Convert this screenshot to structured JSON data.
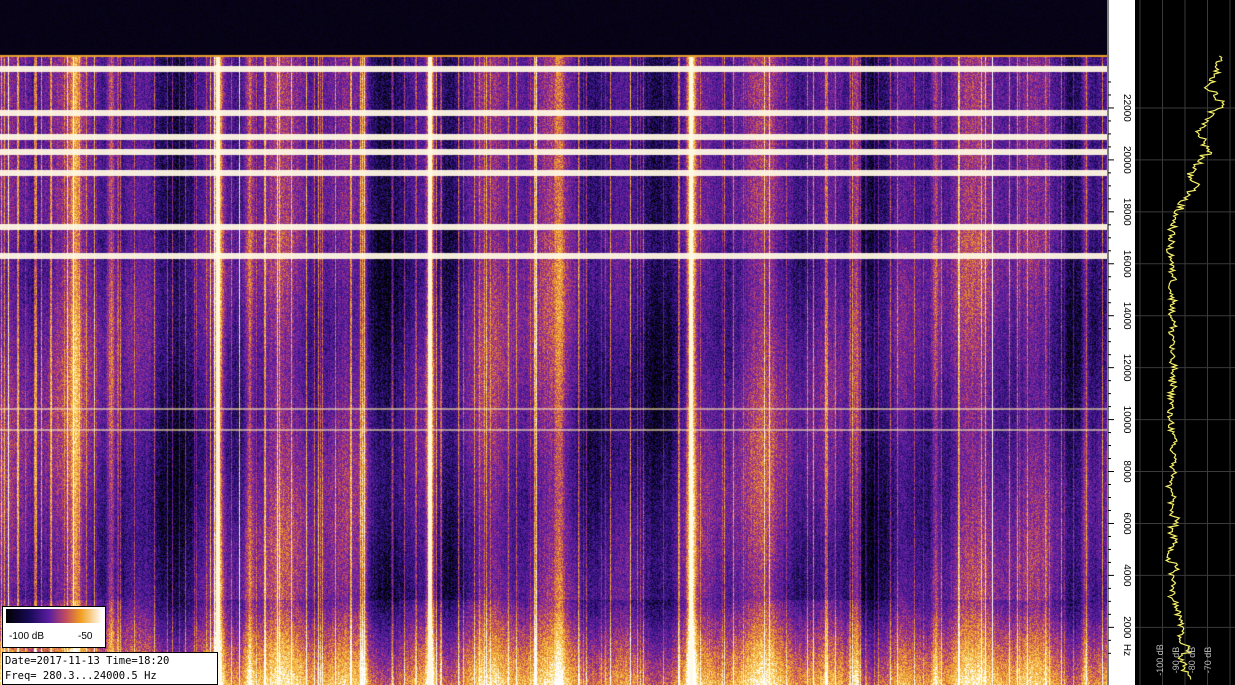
{
  "chart_data": {
    "type": "heatmap",
    "title": "",
    "xlabel": "",
    "ylabel": "Hz",
    "y_axis": {
      "unit": "Hz",
      "ticks": [
        2000,
        4000,
        6000,
        8000,
        10000,
        12000,
        14000,
        16000,
        18000,
        20000,
        22000
      ],
      "range": [
        280.3,
        24000.5
      ],
      "tick_labels": [
        "2000",
        "4000",
        "6000",
        "8000",
        "10000",
        "12000",
        "14000",
        "16000",
        "18000",
        "20000",
        "22000"
      ],
      "unit_label": "Hz"
    },
    "colorbar": {
      "min_label": "-100 dB",
      "max_label": "-50",
      "range_db": [
        -100,
        -50
      ]
    },
    "info": {
      "date_line": "Date=2017-11-13 Time=18:20",
      "freq_line": "Freq= 280.3...24000.5 Hz"
    },
    "horizontal_lines_hz": [
      23500,
      21800,
      20900,
      20300,
      19500,
      17400,
      16300,
      10400,
      9600
    ],
    "vertical_events": [
      {
        "x_frac": 0.197,
        "strength": 0.95
      },
      {
        "x_frac": 0.388,
        "strength": 1.0
      },
      {
        "x_frac": 0.624,
        "strength": 1.0
      },
      {
        "x_frac": 0.773,
        "strength": 0.7
      },
      {
        "x_frac": 0.225,
        "strength": 0.6
      },
      {
        "x_frac": 0.1,
        "strength": 0.6
      },
      {
        "x_frac": 0.328,
        "strength": 0.6
      },
      {
        "x_frac": 0.068,
        "strength": 0.5
      },
      {
        "x_frac": 0.505,
        "strength": 0.4
      },
      {
        "x_frac": 0.845,
        "strength": 0.5
      },
      {
        "x_frac": 0.98,
        "strength": 0.5
      }
    ],
    "spectrum_panel": {
      "axis_labels": [
        "-100 dB",
        "-90 dB",
        "-80 dB",
        "-70 dB"
      ],
      "line_color": "#f5f06a",
      "grid_color": "#3a3a3a",
      "profile_db": [
        -65,
        -66,
        -68,
        -70,
        -67,
        -64,
        -68,
        -71,
        -74,
        -72,
        -69,
        -73,
        -76,
        -78,
        -75,
        -79,
        -82,
        -84,
        -85,
        -86,
        -86,
        -87,
        -86,
        -86,
        -85,
        -86,
        -86,
        -85,
        -86,
        -85,
        -86,
        -85,
        -86,
        -86,
        -85,
        -86,
        -85,
        -86,
        -86,
        -87,
        -86,
        -86,
        -85,
        -86,
        -84,
        -86,
        -85,
        -87,
        -85,
        -86,
        -86,
        -84,
        -86,
        -85,
        -86,
        -87,
        -84,
        -86,
        -85,
        -86,
        -84,
        -83,
        -82,
        -80,
        -82,
        -79,
        -82,
        -80,
        -78
      ]
    }
  }
}
